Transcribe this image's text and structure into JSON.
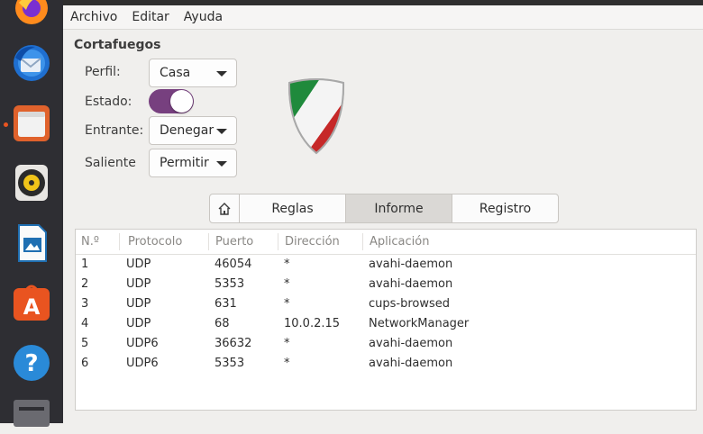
{
  "menu": {
    "items": [
      "Archivo",
      "Editar",
      "Ayuda"
    ]
  },
  "firewall": {
    "title": "Cortafuegos",
    "profile_label": "Perfil:",
    "profile_value": "Casa",
    "status_label": "Estado:",
    "status_on": true,
    "incoming_label": "Entrante:",
    "incoming_value": "Denegar",
    "outgoing_label": "Saliente",
    "outgoing_value": "Permitir"
  },
  "tabs": {
    "reglas": "Reglas",
    "informe": "Informe",
    "registro": "Registro",
    "active": "Informe"
  },
  "table": {
    "headers": [
      "N.º",
      "Protocolo",
      "Puerto",
      "Dirección",
      "Aplicación"
    ],
    "rows": [
      [
        "1",
        "UDP",
        "46054",
        "*",
        "avahi-daemon"
      ],
      [
        "2",
        "UDP",
        "5353",
        "*",
        "avahi-daemon"
      ],
      [
        "3",
        "UDP",
        "631",
        "*",
        "cups-browsed"
      ],
      [
        "4",
        "UDP",
        "68",
        "10.0.2.15",
        "NetworkManager"
      ],
      [
        "5",
        "UDP6",
        "36632",
        "*",
        "avahi-daemon"
      ],
      [
        "6",
        "UDP6",
        "5353",
        "*",
        "avahi-daemon"
      ]
    ]
  },
  "colors": {
    "accent": "#77407f",
    "dock_bg": "#2e2e33",
    "running_indicator": "#e95420"
  },
  "dock": {
    "icons": [
      "firefox-icon",
      "thunderbird-icon",
      "files-icon",
      "rhythmbox-icon",
      "libreoffice-impress-icon",
      "software-center-icon",
      "help-icon",
      "show-apps-icon"
    ]
  }
}
